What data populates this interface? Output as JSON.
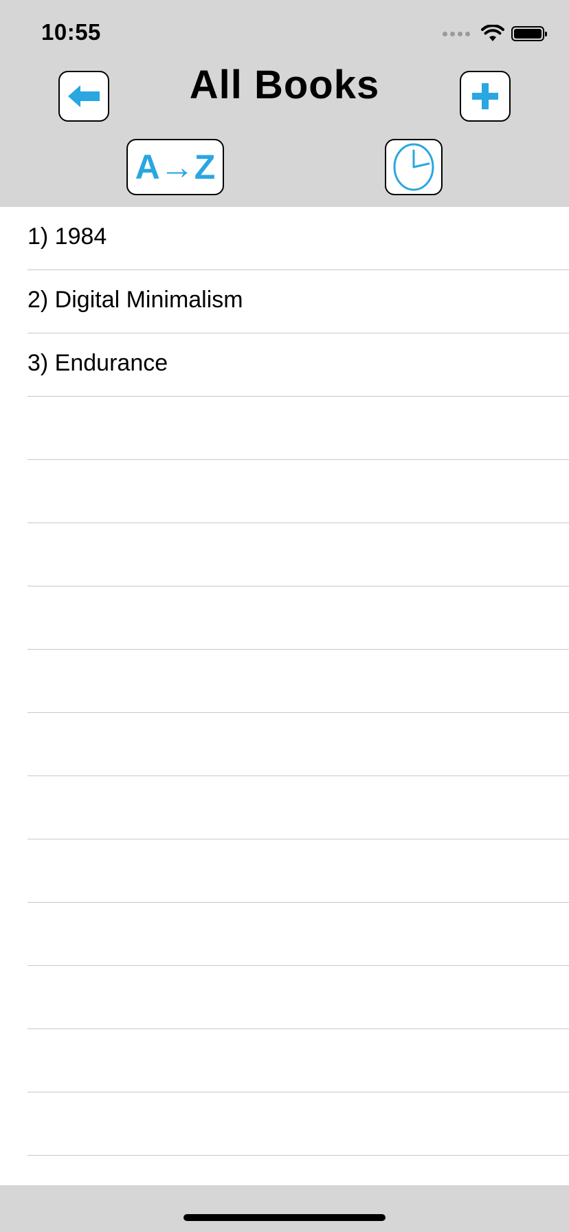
{
  "status_bar": {
    "time": "10:55"
  },
  "header": {
    "title": "All Books",
    "back_icon": "arrow-left-icon",
    "add_icon": "plus-icon",
    "sort_alpha_label": "A→Z",
    "sort_time_icon": "clock-icon",
    "accent_color": "#2aa6e0",
    "background_color": "#d6d6d6"
  },
  "books": [
    {
      "label": "1) 1984"
    },
    {
      "label": "2) Digital Minimalism"
    },
    {
      "label": "3) Endurance"
    },
    {
      "label": ""
    },
    {
      "label": ""
    },
    {
      "label": ""
    },
    {
      "label": ""
    },
    {
      "label": ""
    },
    {
      "label": ""
    },
    {
      "label": ""
    },
    {
      "label": ""
    },
    {
      "label": ""
    },
    {
      "label": ""
    },
    {
      "label": ""
    },
    {
      "label": ""
    }
  ]
}
